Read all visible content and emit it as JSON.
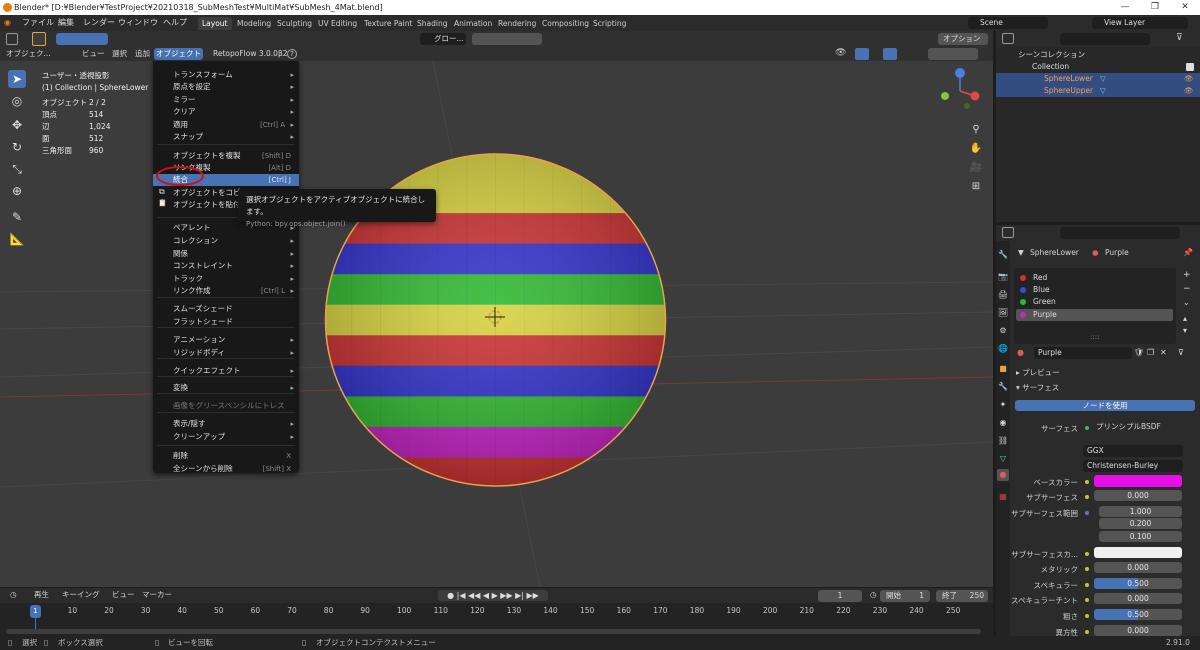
{
  "titlebar": {
    "title": "Blender* [D:¥Blender¥TestProject¥20210318_SubMeshTest¥MultiMat¥SubMesh_4Mat.blend]",
    "minimize": "—",
    "maximize": "❐",
    "close": "✕"
  },
  "topmenu": [
    "ファイル",
    "編集",
    "レンダー",
    "ウィンドウ",
    "ヘルプ"
  ],
  "workspaces": [
    {
      "label": "Layout",
      "active": true
    },
    {
      "label": "Modeling"
    },
    {
      "label": "Sculpting"
    },
    {
      "label": "UV Editing"
    },
    {
      "label": "Texture Paint"
    },
    {
      "label": "Shading"
    },
    {
      "label": "Animation"
    },
    {
      "label": "Rendering"
    },
    {
      "label": "Compositing"
    },
    {
      "label": "Scripting"
    }
  ],
  "scene": {
    "label": "Scene"
  },
  "view_layer": {
    "label": "View Layer"
  },
  "header3d": {
    "mode": "オブジェク...",
    "menus": [
      "ビュー",
      "選択",
      "追加",
      "オブジェクト"
    ],
    "addon": "RetopoFlow 3.0.0β2",
    "transform": "グロー...",
    "options": "オプション"
  },
  "viewport_info": {
    "view": "ユーザー・透視投影",
    "collection": "(1) Collection | SphereLower"
  },
  "stats": [
    {
      "label": "オブジェクト",
      "value": "2 / 2"
    },
    {
      "label": "頂点",
      "value": "514"
    },
    {
      "label": "辺",
      "value": "1,024"
    },
    {
      "label": "面",
      "value": "512"
    },
    {
      "label": "三角形面",
      "value": "960"
    }
  ],
  "object_menu": {
    "items": [
      {
        "label": "トランスフォーム",
        "arrow": "▸"
      },
      {
        "label": "原点を設定",
        "arrow": "▸"
      },
      {
        "label": "ミラー",
        "arrow": "▸"
      },
      {
        "label": "クリア",
        "arrow": "▸"
      },
      {
        "label": "適用",
        "shortcut": "[Ctrl] A",
        "arrow": "▸"
      },
      {
        "label": "スナップ",
        "arrow": "▸"
      },
      {
        "label": "オブジェクトを複製",
        "shortcut": "[Shift] D"
      },
      {
        "label": "リンク複製",
        "shortcut": "[Alt] D"
      },
      {
        "label": "統合",
        "shortcut": "[Ctrl] J",
        "highlight": true
      },
      {
        "label": "オブジェクトをコピー"
      },
      {
        "label": "オブジェクトを貼付"
      },
      {
        "label": "ペアレント",
        "arrow": "▸"
      },
      {
        "label": "コレクション",
        "arrow": "▸"
      },
      {
        "label": "関係",
        "arrow": "▸"
      },
      {
        "label": "コンストレイント",
        "arrow": "▸"
      },
      {
        "label": "トラック",
        "arrow": "▸"
      },
      {
        "label": "リンク作成",
        "shortcut": "[Ctrl] L",
        "arrow": "▸"
      },
      {
        "label": "スムーズシェード"
      },
      {
        "label": "フラットシェード"
      },
      {
        "label": "アニメーション",
        "arrow": "▸"
      },
      {
        "label": "リジッドボディ",
        "arrow": "▸"
      },
      {
        "label": "クイックエフェクト",
        "arrow": "▸"
      },
      {
        "label": "変換",
        "arrow": "▸"
      },
      {
        "label": "画像をグリースペンシルにトレス",
        "disabled": true
      },
      {
        "label": "表示/隠す",
        "arrow": "▸"
      },
      {
        "label": "クリーンアップ",
        "arrow": "▸"
      },
      {
        "label": "削除",
        "shortcut": "X"
      },
      {
        "label": "全シーンから削除",
        "shortcut": "[Shift] X"
      }
    ]
  },
  "tooltip": {
    "text": "選択オブジェクトをアクティブオブジェクトに統合します。",
    "python": "Python: bpy.ops.object.join()"
  },
  "sphere_band_colors": [
    "#d8d13e",
    "#d8d13e",
    "#c92f2f",
    "#2f2fc9",
    "#2eb82e",
    "#d8d13e",
    "#c92f2f",
    "#2f2fc9",
    "#2eb82e",
    "#c320c3",
    "#c92f2f"
  ],
  "timeline": {
    "menus": [
      "再生",
      "キーイング",
      "ビュー",
      "マーカー"
    ],
    "current_frame": "1",
    "start_label": "開始",
    "start": "1",
    "end_label": "終了",
    "end": "250",
    "ticks": [
      "10",
      "20",
      "30",
      "40",
      "50",
      "60",
      "70",
      "80",
      "90",
      "100",
      "110",
      "120",
      "130",
      "140",
      "150",
      "160",
      "170",
      "180",
      "190",
      "200",
      "210",
      "220",
      "230",
      "240",
      "250"
    ],
    "playhead": "1"
  },
  "statusbar": {
    "select": "選択",
    "box": "ボックス選択",
    "rotate": "ビューを回転",
    "context": "オブジェクトコンテクストメニュー",
    "version": "2.91.0"
  },
  "outliner": {
    "scene_collection": "シーンコレクション",
    "collection": "Collection",
    "objects": [
      {
        "name": "SphereLower",
        "selected": true
      },
      {
        "name": "SphereUpper",
        "selected": true
      }
    ]
  },
  "properties": {
    "object": "SphereLower",
    "material": "Purple",
    "materials": [
      {
        "name": "Red",
        "color": "#d63030"
      },
      {
        "name": "Blue",
        "color": "#2f4fd6"
      },
      {
        "name": "Green",
        "color": "#2fb82f"
      },
      {
        "name": "Purple",
        "color": "#c229c2",
        "selected": true
      }
    ],
    "dots": "::::",
    "material_field": "Purple",
    "preview": "プレビュー",
    "surface_section": "サーフェス",
    "use_nodes": "ノードを使用",
    "surface_label": "サーフェス",
    "surface_value": "プリンシプルBSDF",
    "distribution": "GGX",
    "subsurface_method": "Christensen-Burley",
    "base_color_label": "ベースカラー",
    "base_color": "#e60fe6",
    "rows": [
      {
        "label": "サブサーフェス",
        "value": "0.000"
      },
      {
        "label": "サブサーフェス範囲",
        "value": "1.000"
      },
      {
        "label": "",
        "value": "0.200"
      },
      {
        "label": "",
        "value": "0.100"
      },
      {
        "label": "サブサーフェスカ...",
        "value": ""
      },
      {
        "label": "メタリック",
        "value": "0.000"
      },
      {
        "label": "スペキュラー",
        "value": "0.500"
      },
      {
        "label": "スペキュラーチント",
        "value": "0.000"
      },
      {
        "label": "粗さ",
        "value": "0.500"
      },
      {
        "label": "異方性",
        "value": "0.000"
      }
    ]
  }
}
